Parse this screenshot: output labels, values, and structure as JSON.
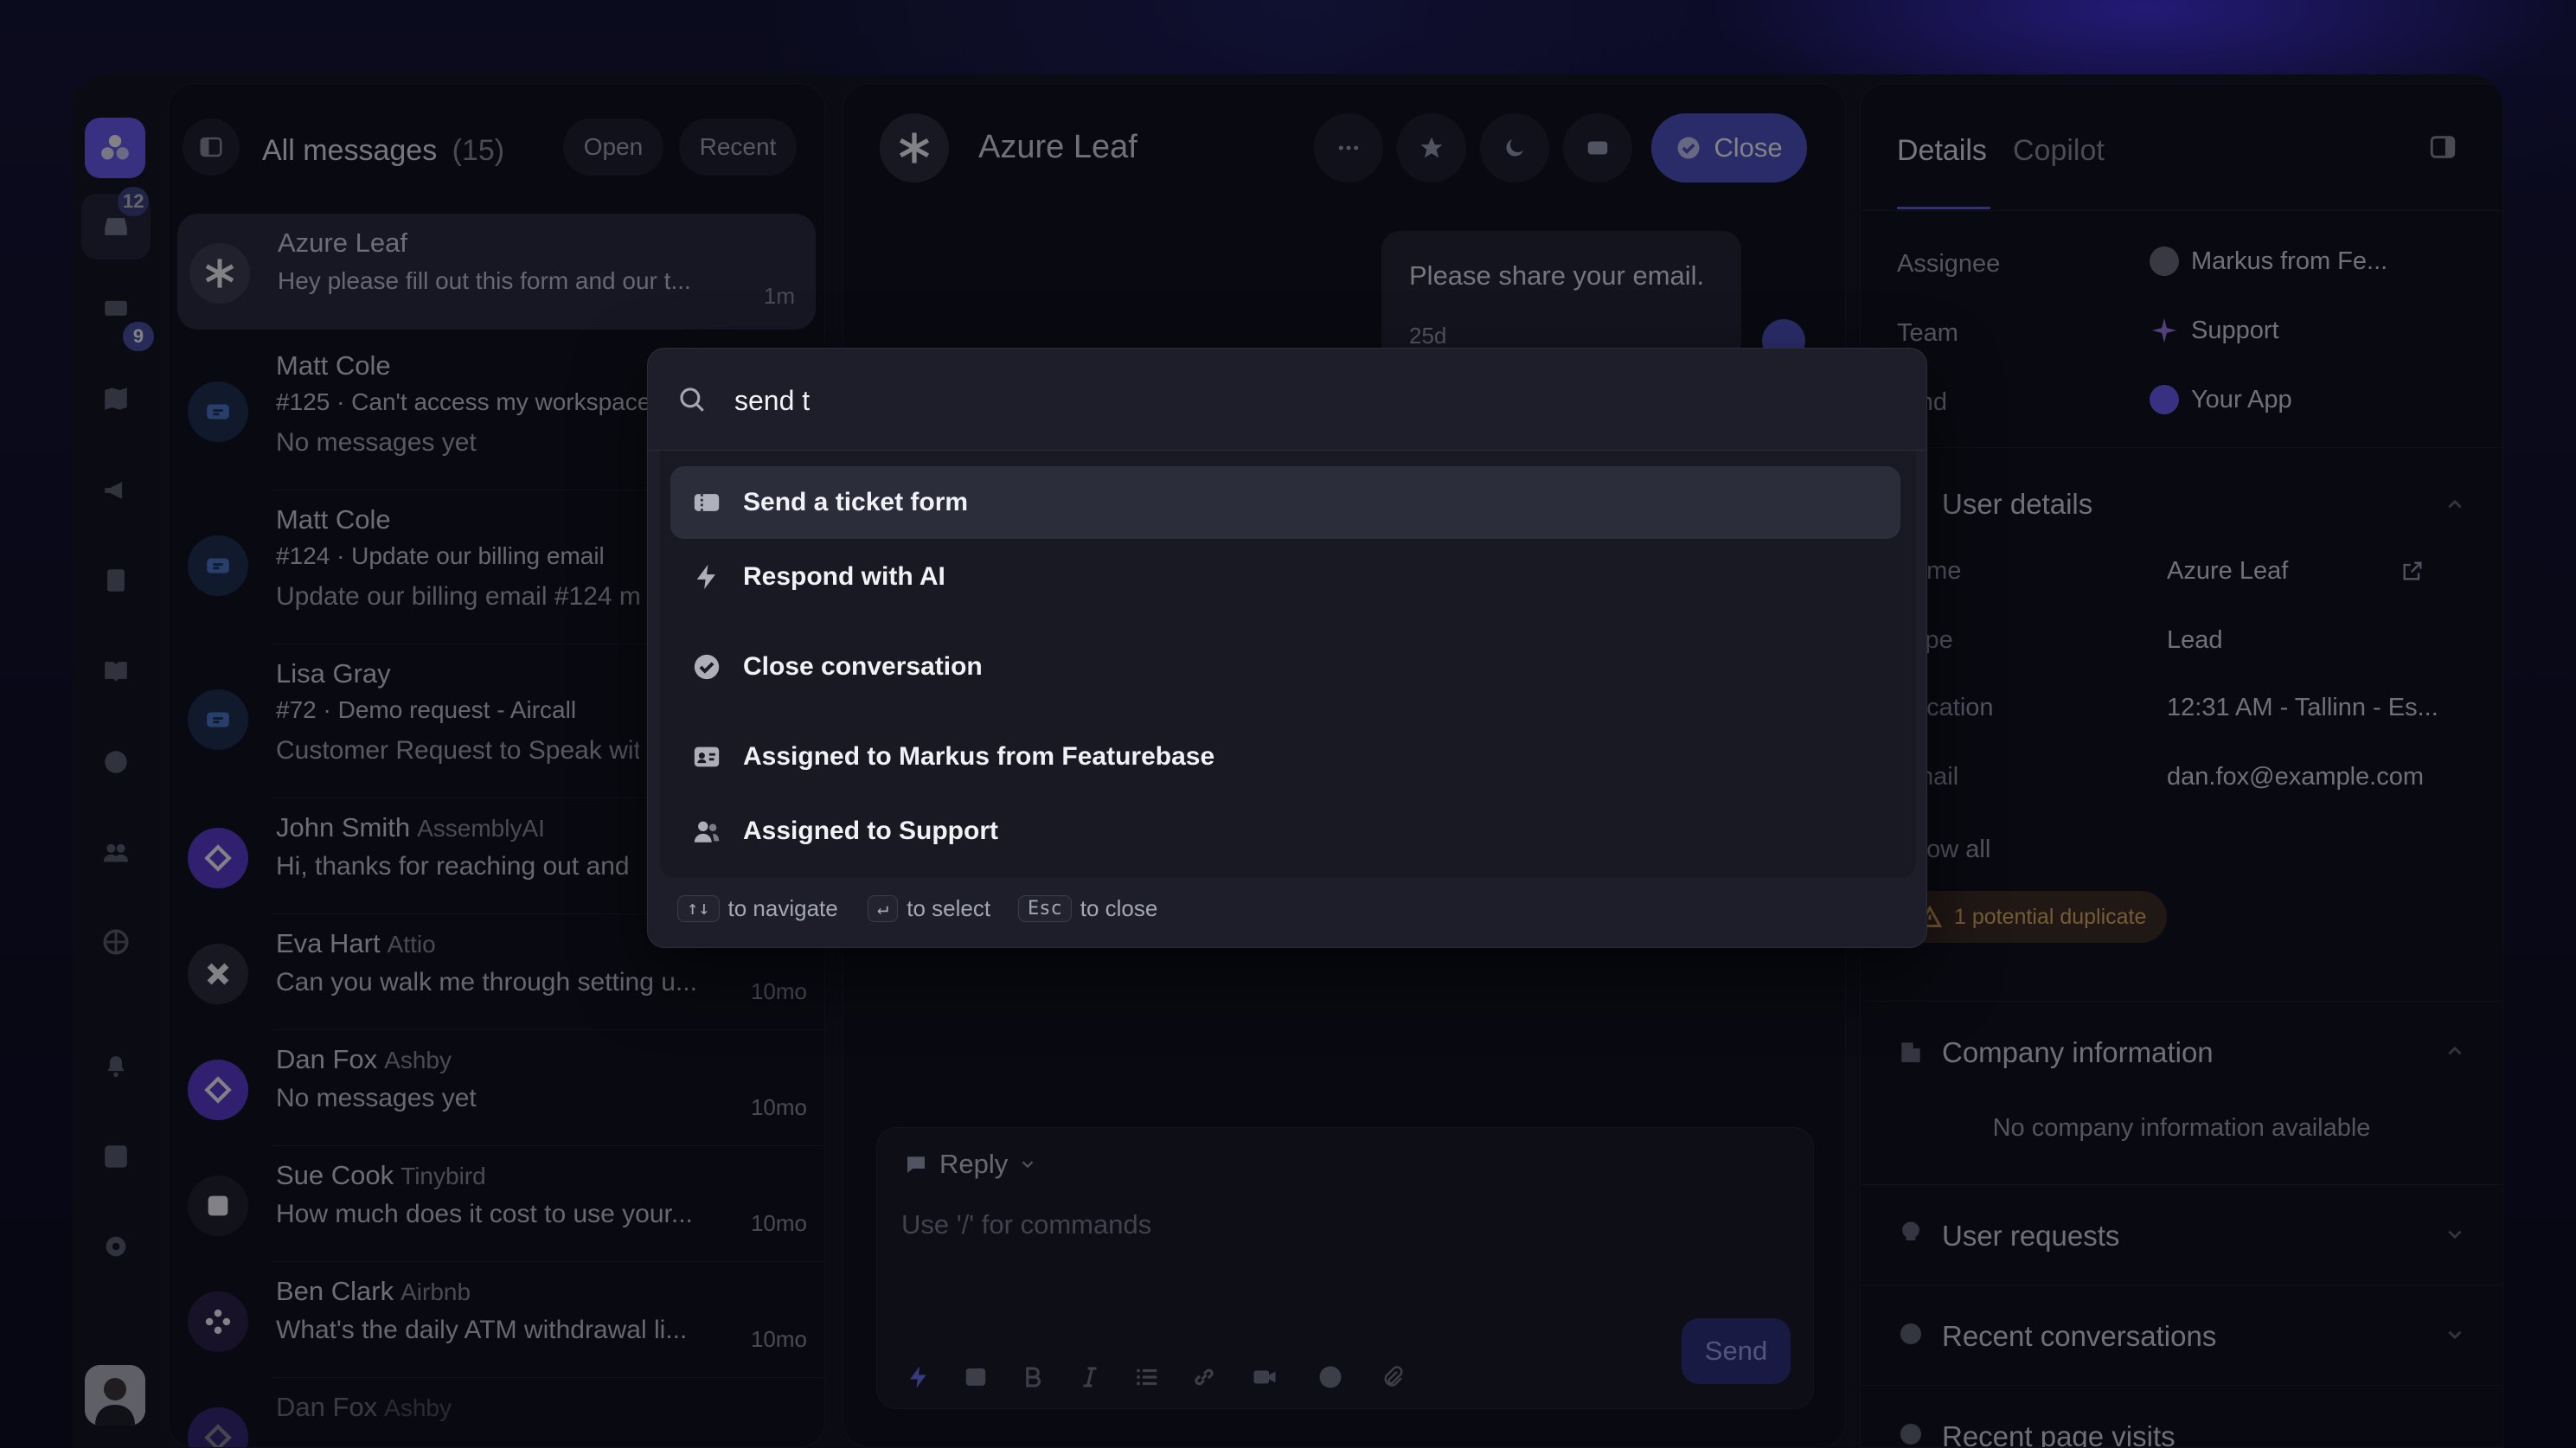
{
  "rail": {
    "inbox_badge": "12",
    "tickets_badge": "9"
  },
  "list": {
    "title": "All messages",
    "count": "(15)",
    "filter_open": "Open",
    "filter_recent": "Recent",
    "items": [
      {
        "name": "Azure Leaf",
        "company": "",
        "line2": "Hey please fill out this form and our t...",
        "line3": "",
        "time": "1m"
      },
      {
        "name": "Matt Cole",
        "company": "",
        "line2": "#125 · Can't access my workspace",
        "line3": "No messages yet",
        "time": ""
      },
      {
        "name": "Matt Cole",
        "company": "",
        "line2": "#124 · Update our billing email",
        "line3": "Update our billing email #124 m",
        "time": ""
      },
      {
        "name": "Lisa Gray",
        "company": "",
        "line2": "#72 · Demo request - Aircall",
        "line3": "Customer Request to Speak wit",
        "time": ""
      },
      {
        "name": "John Smith",
        "company": "AssemblyAI",
        "line2": "Hi, thanks for reaching out and",
        "line3": "",
        "time": ""
      },
      {
        "name": "Eva Hart",
        "company": "Attio",
        "line2": "Can you walk me through setting u...",
        "line3": "",
        "time": "10mo"
      },
      {
        "name": "Dan Fox",
        "company": "Ashby",
        "line2": "No messages yet",
        "line3": "",
        "time": "10mo"
      },
      {
        "name": "Sue Cook",
        "company": "Tinybird",
        "line2": "How much does it cost to use your...",
        "line3": "",
        "time": "10mo"
      },
      {
        "name": "Ben Clark",
        "company": "Airbnb",
        "line2": "What's the daily ATM withdrawal li...",
        "line3": "",
        "time": "10mo"
      },
      {
        "name": "Dan Fox",
        "company": "Ashby",
        "line2": "",
        "line3": "",
        "time": ""
      }
    ]
  },
  "chat": {
    "title": "Azure Leaf",
    "close_label": "Close",
    "bubble_text": "Please share your email.",
    "bubble_time": "25d",
    "reply_label": "Reply",
    "composer_placeholder": "Use '/' for commands",
    "send_label": "Send"
  },
  "details": {
    "tab_details": "Details",
    "tab_copilot": "Copilot",
    "assignee_label": "Assignee",
    "assignee_value": "Markus from Fe...",
    "team_label": "Team",
    "team_value": "Support",
    "brand_label": "rand",
    "brand_value": "Your App",
    "user_details_title": "User details",
    "name_label": "ame",
    "name_value": "Azure Leaf",
    "type_label": "ype",
    "type_value": "Lead",
    "location_label": "ocation",
    "location_value": "12:31 AM - Tallinn - Es...",
    "email_label": "mail",
    "email_value": "dan.fox@example.com",
    "show_all": "how all",
    "duplicate": "1 potential duplicate",
    "company_title": "Company information",
    "company_empty": "No company information available",
    "requests_title": "User requests",
    "recent_title": "Recent conversations",
    "pages_title": "Recent page visits"
  },
  "palette": {
    "query": "send t",
    "commands": [
      {
        "label": "Send a ticket form",
        "icon": "ticket-icon"
      },
      {
        "label": "Respond with AI",
        "icon": "bolt-icon"
      },
      {
        "label": "Close conversation",
        "icon": "check-circle-icon"
      },
      {
        "label": "Assigned to Markus from Featurebase",
        "icon": "id-card-icon"
      },
      {
        "label": "Assigned to Support",
        "icon": "team-icon"
      }
    ],
    "hint_nav_key": "↑↓",
    "hint_nav": "to navigate",
    "hint_select_key": "↵",
    "hint_select": "to select",
    "hint_close_key": "Esc",
    "hint_close": "to close"
  },
  "colors": {
    "accent": "#4f52c4",
    "brand": "#6b5bf2",
    "duplicate_bg": "#3a2a1c",
    "duplicate_fg": "#e8b15a"
  }
}
